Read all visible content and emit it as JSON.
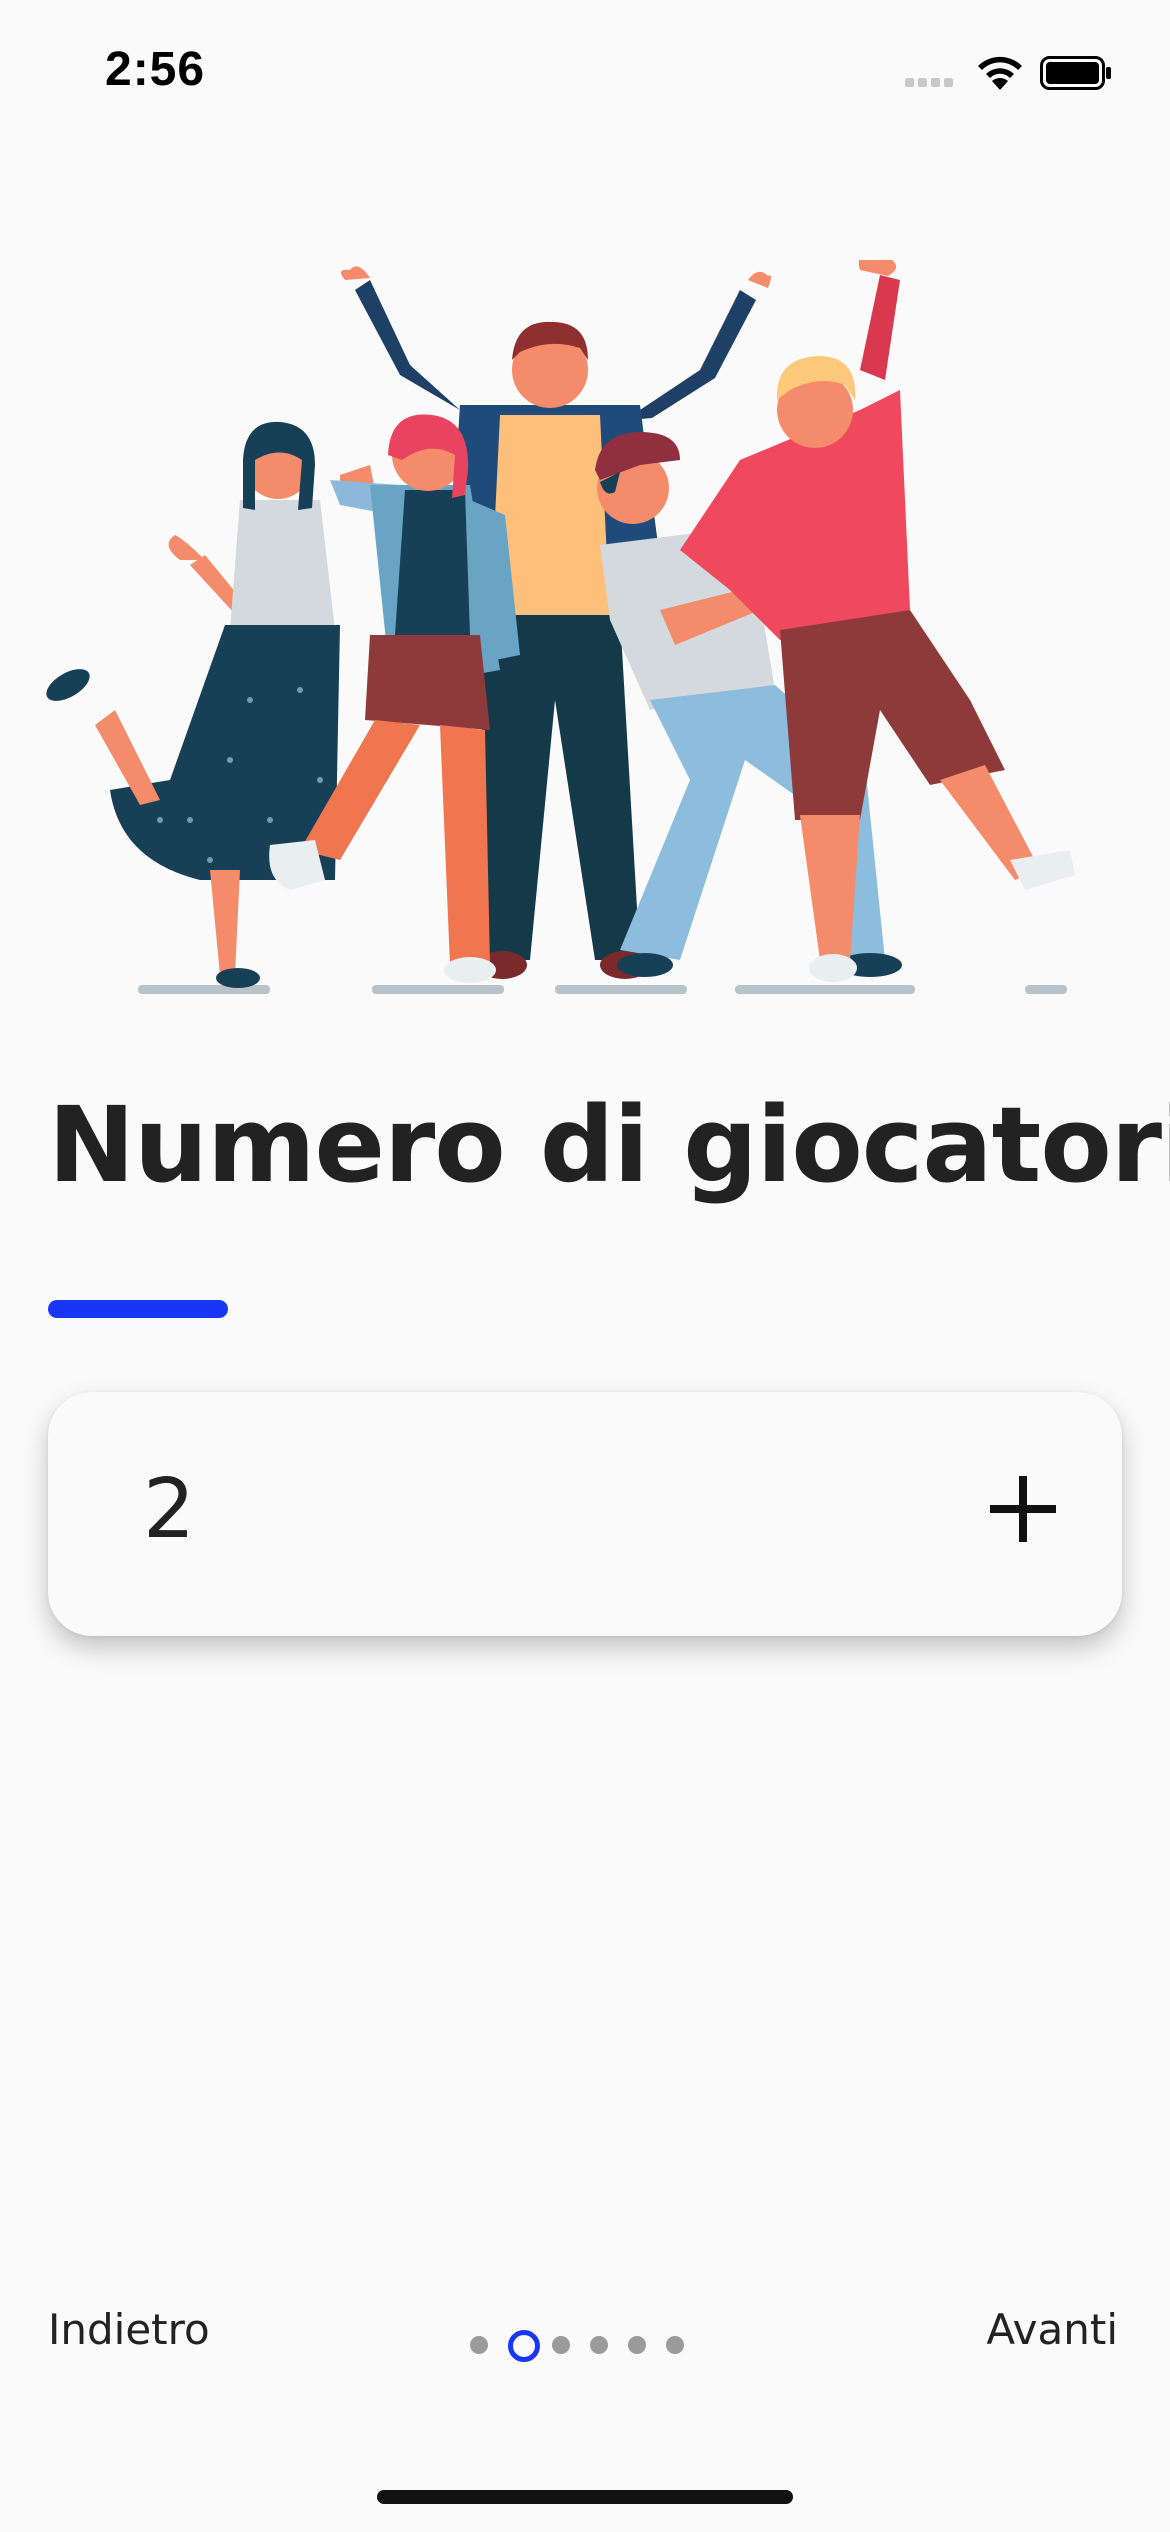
{
  "status_bar": {
    "time": "2:56"
  },
  "screen": {
    "title": "Numero di giocatori",
    "accent_color": "#1a36f5"
  },
  "player_count": {
    "value": "2",
    "increment_icon": "plus-icon"
  },
  "footer": {
    "back_label": "Indietro",
    "next_label": "Avanti",
    "pagination": {
      "total_pages": 6,
      "current_page": 2
    }
  }
}
